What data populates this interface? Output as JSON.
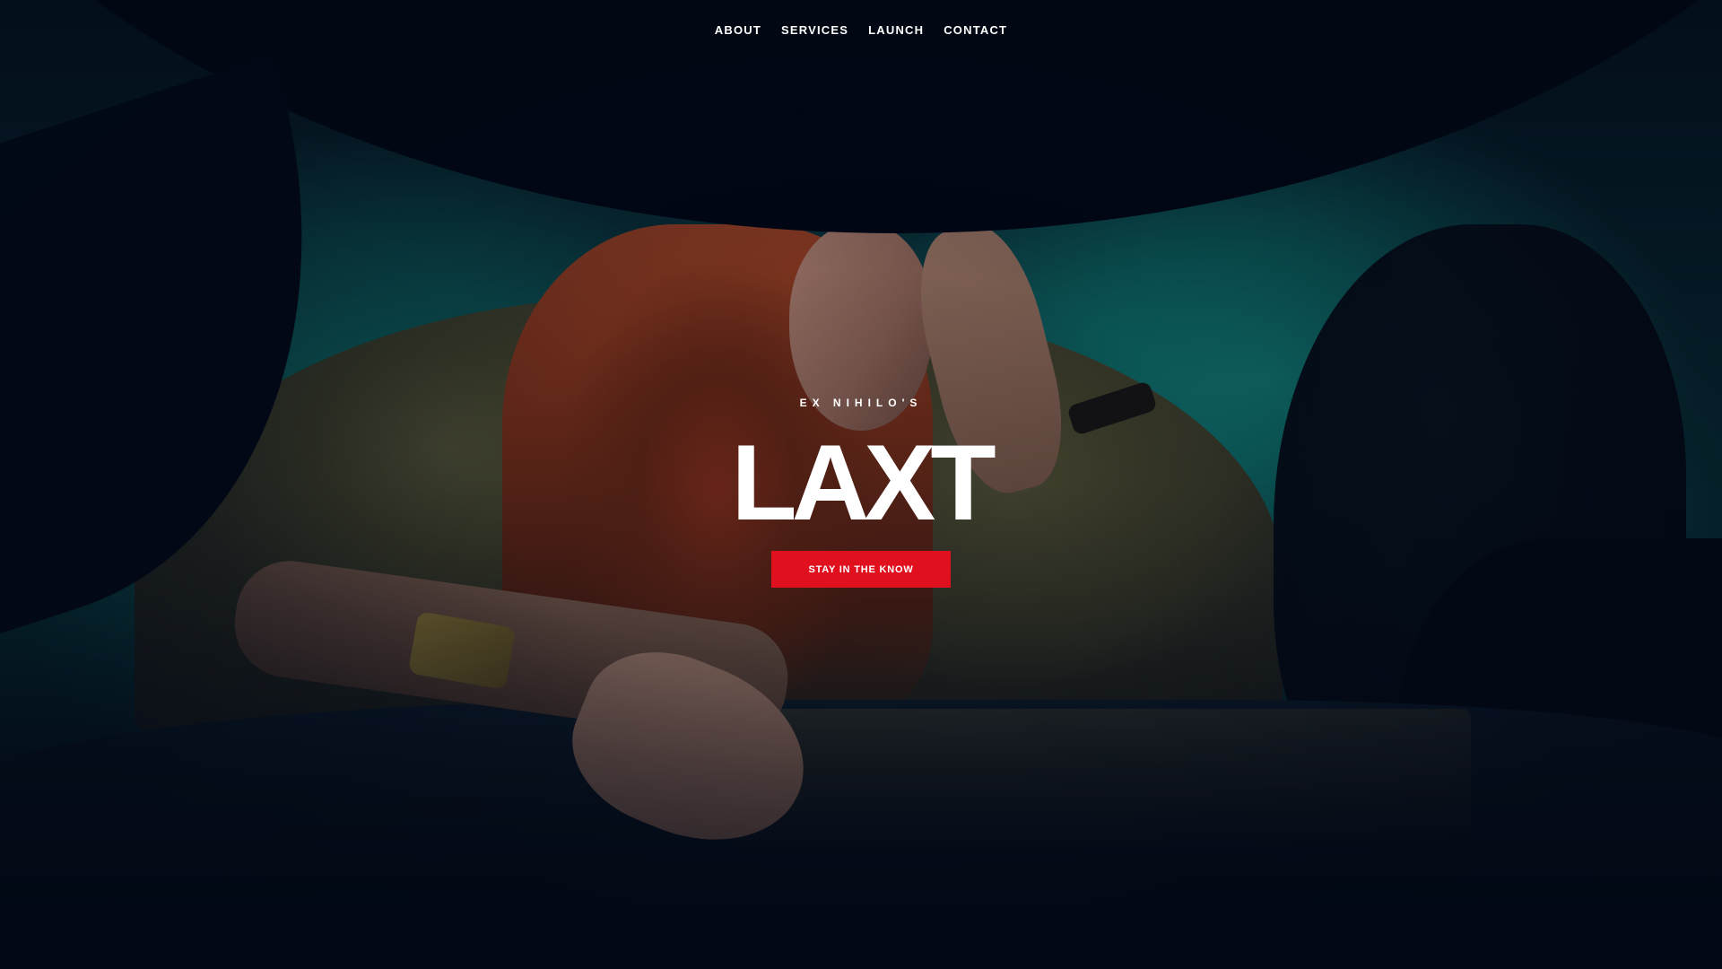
{
  "nav": {
    "items": [
      {
        "label": "ABOUT"
      },
      {
        "label": "SERVICES"
      },
      {
        "label": "LAUNCH"
      },
      {
        "label": "CONTACT"
      }
    ]
  },
  "hero": {
    "kicker": "EX NIHILO'S",
    "title": "LAXT",
    "cta_label": "STAY IN THE KNOW",
    "background_image": "woman-leaning-into-car-window-photo"
  },
  "colors": {
    "background": "#020815",
    "accent": "#e0101e",
    "text": "#ffffff"
  }
}
